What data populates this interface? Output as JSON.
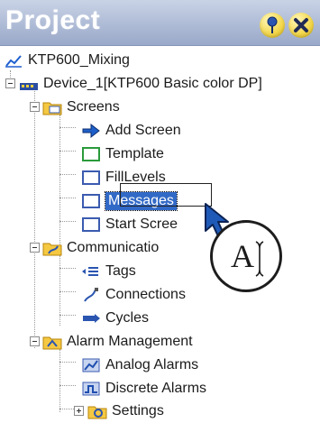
{
  "panel": {
    "title": "Project",
    "pin_icon": "pin-icon",
    "close_icon": "close-icon",
    "header_color": "#aebbd6"
  },
  "tree": {
    "project": "KTP600_Mixing",
    "device": "Device_1[KTP600 Basic color DP]",
    "screens": {
      "label": "Screens",
      "items": [
        "Add Screen",
        "Template",
        "FillLevels",
        "Messages",
        "Start Scree"
      ]
    },
    "communication": {
      "label": "Communicatio",
      "items": [
        "Tags",
        "Connections",
        "Cycles"
      ]
    },
    "alarm_management": {
      "label": "Alarm Management",
      "items": [
        "Analog Alarms",
        "Discrete Alarms",
        "Settings"
      ]
    }
  },
  "cursor_badge": {
    "text": "A"
  },
  "selection_color": "#3169c6"
}
